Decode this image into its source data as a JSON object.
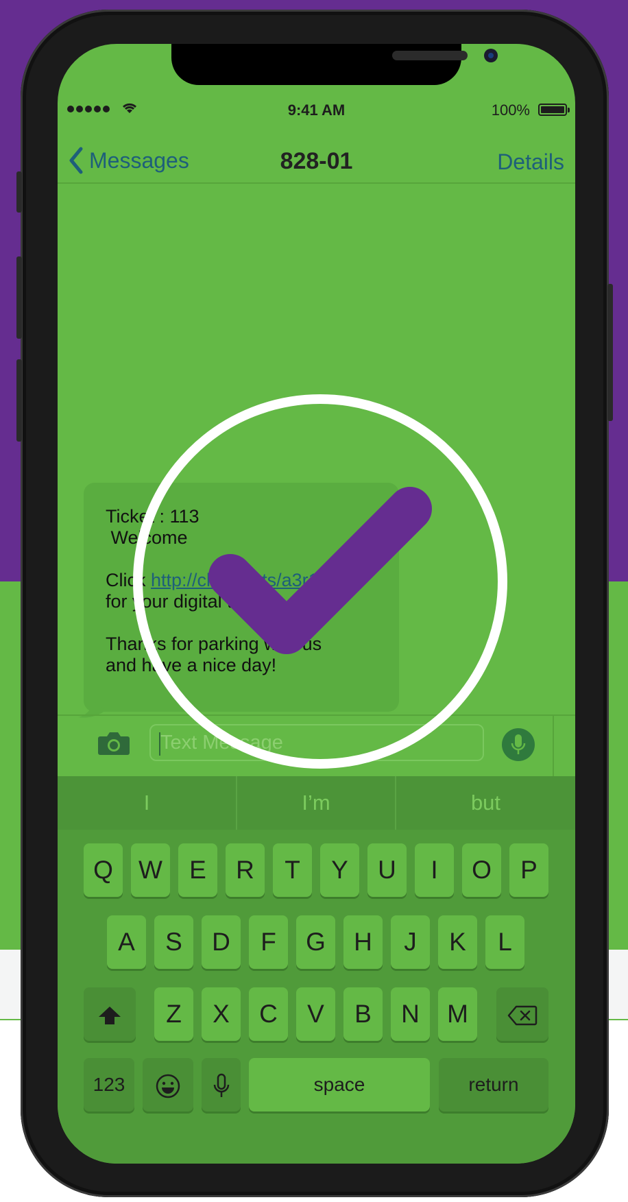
{
  "status_bar": {
    "time": "9:41 AM",
    "battery": "100%"
  },
  "nav": {
    "back_label": "Messages",
    "title": "828-01",
    "details_label": "Details"
  },
  "message": {
    "line1": "Ticket : 113",
    "line2": " Welcome",
    "click_prefix": "Click ",
    "link": "http://cleaneats/a3r1",
    "line4": "for your digital ticket",
    "line5": "Thanks for parking with us",
    "line6": "and have a nice day!"
  },
  "input": {
    "placeholder": "Text Message"
  },
  "predictive": [
    "I",
    "I’m",
    "but"
  ],
  "keyboard": {
    "row1": [
      "Q",
      "W",
      "E",
      "R",
      "T",
      "Y",
      "U",
      "I",
      "O",
      "P"
    ],
    "row2": [
      "A",
      "S",
      "D",
      "F",
      "G",
      "H",
      "J",
      "K",
      "L"
    ],
    "row3": [
      "Z",
      "X",
      "C",
      "V",
      "B",
      "N",
      "M"
    ],
    "numbers_label": "123",
    "space_label": "space",
    "return_label": "return"
  },
  "colors": {
    "purple": "#652d90",
    "green": "#64b946",
    "link": "#1e5f7a"
  },
  "icons": [
    "chevron-left-icon",
    "camera-icon",
    "microphone-icon",
    "shift-icon",
    "backspace-icon",
    "emoji-icon",
    "wifi-icon",
    "battery-icon",
    "checkmark-icon"
  ]
}
